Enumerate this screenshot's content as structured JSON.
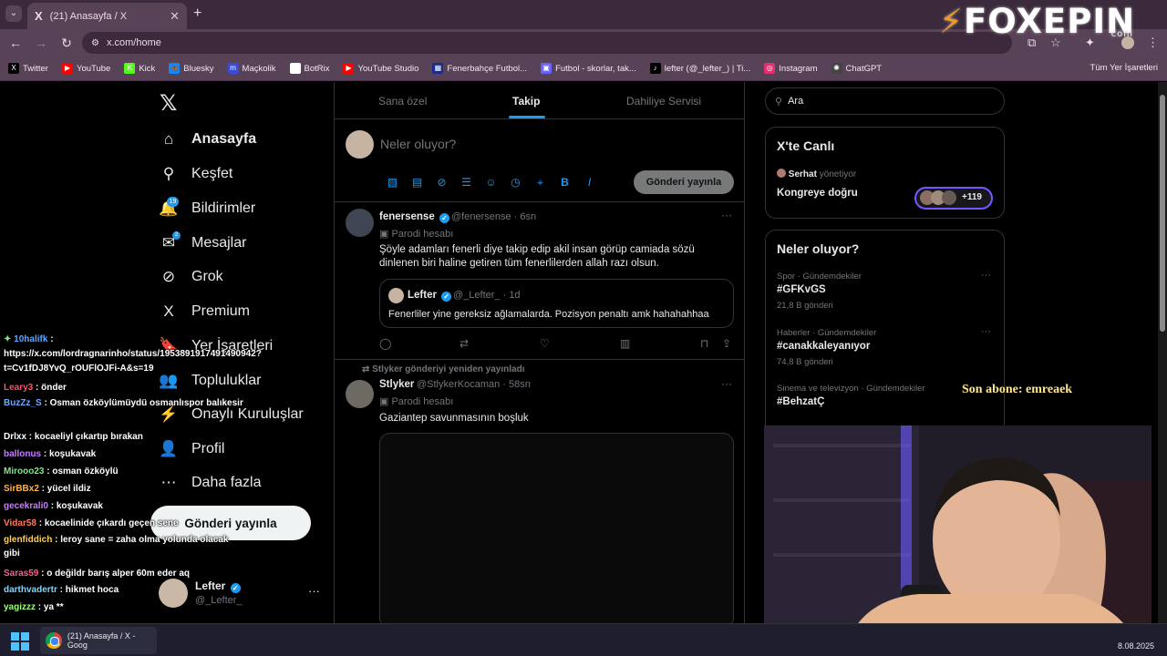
{
  "browser": {
    "tab_title": "(21) Anasayfa / X",
    "tab_close": "✕",
    "new_tab": "+",
    "url": "x.com/home",
    "bookmarks": [
      {
        "label": "Twitter",
        "icon": "x-icon",
        "color": "#000000",
        "glyph": "X"
      },
      {
        "label": "YouTube",
        "icon": "youtube-icon",
        "color": "#ff0000",
        "glyph": "▶"
      },
      {
        "label": "Kick",
        "icon": "kick-icon",
        "color": "#53fc18",
        "glyph": "K"
      },
      {
        "label": "Bluesky",
        "icon": "bluesky-icon",
        "color": "#1185fe",
        "glyph": "🦋"
      },
      {
        "label": "Maçkolik",
        "icon": "mackolik-icon",
        "color": "#3a4bd8",
        "glyph": "m"
      },
      {
        "label": "BotRix",
        "icon": "botrix-icon",
        "color": "#ffffff",
        "glyph": "◆"
      },
      {
        "label": "YouTube Studio",
        "icon": "youtube-studio-icon",
        "color": "#ff0000",
        "glyph": "▶"
      },
      {
        "label": "Fenerbahçe Futbol...",
        "icon": "fenerbahce-icon",
        "color": "#1c2c8c",
        "glyph": "▦"
      },
      {
        "label": "Futbol - skorlar, tak...",
        "icon": "flashscore-icon",
        "color": "#6c63ff",
        "glyph": "▣"
      },
      {
        "label": "lefter (@_lefter_) | Ti...",
        "icon": "tiktok-icon",
        "color": "#000000",
        "glyph": "♪"
      },
      {
        "label": "Instagram",
        "icon": "instagram-icon",
        "color": "#e1306c",
        "glyph": "◎"
      },
      {
        "label": "ChatGPT",
        "icon": "chatgpt-icon",
        "color": "#444444",
        "glyph": "✺"
      }
    ],
    "all_bookmarks": "Tüm Yer İşaretleri"
  },
  "overlay": {
    "logo_text": "FOXEPIN",
    "logo_domain": "com",
    "sub_alert": "Son abone: emreaek"
  },
  "sidebar": {
    "nav": [
      {
        "label": "Anasayfa",
        "icon": "home-icon",
        "glyph": "⌂",
        "active": true
      },
      {
        "label": "Keşfet",
        "icon": "search-icon",
        "glyph": "⚲"
      },
      {
        "label": "Bildirimler",
        "icon": "bell-icon",
        "glyph": "🔔"
      },
      {
        "label": "Mesajlar",
        "icon": "mail-icon",
        "glyph": "✉"
      },
      {
        "label": "Grok",
        "icon": "grok-icon",
        "glyph": "⊘"
      },
      {
        "label": "Premium",
        "icon": "premium-x-icon",
        "glyph": "X"
      },
      {
        "label": "Yer İşaretleri",
        "icon": "bookmark-icon",
        "glyph": "🔖"
      },
      {
        "label": "Topluluklar",
        "icon": "communities-icon",
        "glyph": "👥"
      },
      {
        "label": "Onaylı Kuruluşlar",
        "icon": "lightning-icon",
        "glyph": "⚡"
      },
      {
        "label": "Profil",
        "icon": "profile-icon",
        "glyph": "👤"
      },
      {
        "label": "Daha fazla",
        "icon": "more-circle-icon",
        "glyph": "⋯"
      }
    ],
    "notif_count": "19",
    "msg_count": "2",
    "post_button": "Gönderi yayınla",
    "account": {
      "name": "Lefter",
      "handle": "@_Lefter_",
      "more": "···"
    }
  },
  "main": {
    "tabs": [
      "Sana özel",
      "Takip",
      "Dahiliye Servisi"
    ],
    "active_tab": "Takip",
    "composer_placeholder": "Neler oluyor?",
    "composer_post": "Gönderi yayınla",
    "tweets": [
      {
        "name": "fenersense",
        "handle": "@fenersense",
        "time": "6sn",
        "badge": "Parodi hesabı",
        "text": "Şöyle adamları fenerli diye takip edip akil insan görüp camiada sözü dinlenen biri haline getiren tüm fenerlilerden allah razı olsun.",
        "quote": {
          "name": "Lefter",
          "handle": "@_Lefter_",
          "time": "1d",
          "text": "Fenerliler yine gereksiz ağlamalarda. Pozisyon penaltı amk hahahahhaa"
        }
      },
      {
        "retweet_by": "Stlyker gönderiyi yeniden yayınladı",
        "name": "Stlyker",
        "handle": "@StlykerKocaman",
        "time": "58sn",
        "badge": "Parodi hesabı",
        "text": "Gaziantep savunmasının boşluk"
      }
    ]
  },
  "right": {
    "search_placeholder": "Ara",
    "live": {
      "title": "X'te Canlı",
      "host": "Serhat",
      "host_suffix": "yönetiyor",
      "topic": "Kongreye doğru",
      "count": "+119"
    },
    "trends": {
      "title": "Neler oluyor?",
      "items": [
        {
          "category": "Spor · Gündemdekiler",
          "name": "#GFKvGS",
          "count": "21,8 B gönderi"
        },
        {
          "category": "Haberler · Gündemdekiler",
          "name": "#canakkaleyanıyor",
          "count": "74,8 B gönderi"
        },
        {
          "category": "Sinema ve televizyon · Gündemdekiler",
          "name": "#BehzatÇ",
          "count": ""
        }
      ]
    }
  },
  "chat": [
    {
      "user": "10halifk",
      "msg": "https://x.com/lordragnarinho/status/1953891917491490942?t=Cv1fDJ8YvQ_rOUFlOJFi-A&s=19",
      "color": "#5aa7ff"
    },
    {
      "user": "Leary3",
      "msg": "önder",
      "color": "#ff4f6a"
    },
    {
      "user": "BuzZz_S",
      "msg": "Osman özköylümüydü osmanlıspor balıkesir",
      "color": "#6ea8ff"
    },
    {
      "user": "Drlxx",
      "msg": "kocaeliyl çıkartıp bırakan",
      "color": "#ffffff"
    },
    {
      "user": "ballonus",
      "msg": "koşukavak",
      "color": "#c77dff"
    },
    {
      "user": "Mirooo23",
      "msg": "osman özköylü",
      "color": "#7ee787"
    },
    {
      "user": "SirBBx2",
      "msg": "yücel ildiz",
      "color": "#ffb347"
    },
    {
      "user": "gecekrali0",
      "msg": "koşukavak",
      "color": "#c77dff"
    },
    {
      "user": "Vidar58",
      "msg": "kocaelinide çıkardı geçen sene",
      "color": "#ff7a59"
    },
    {
      "user": "glenfiddich",
      "msg": "leroy sane = zaha olma yolunda olacak gibi",
      "color": "#ffcf5a"
    },
    {
      "user": "Saras59",
      "msg": "o değildr barış alper 60m eder aq",
      "color": "#ff5c8a"
    },
    {
      "user": "darthvadertr",
      "msg": "hikmet hoca",
      "color": "#7fd6ff"
    },
    {
      "user": "yagizzz",
      "msg": "ya **",
      "color": "#9cff7a"
    }
  ],
  "taskbar": {
    "window_title": "(21) Anasayfa / X - Goog",
    "date": "8.08.2025"
  }
}
